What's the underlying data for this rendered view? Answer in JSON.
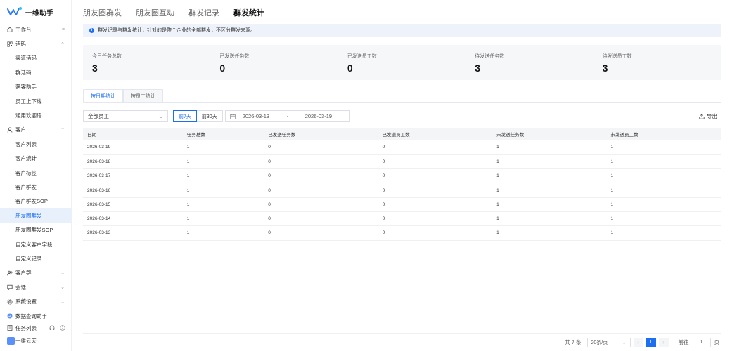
{
  "app": {
    "logo_text": "一维助手"
  },
  "sidebar": {
    "items": [
      {
        "label": "工作台",
        "icon": "home-icon",
        "right": "≡",
        "indent": false
      },
      {
        "label": "活码",
        "icon": "qrcode-icon",
        "right": "⌃",
        "indent": false
      },
      {
        "label": "渠道活码",
        "icon": "",
        "right": "",
        "indent": true
      },
      {
        "label": "群活码",
        "icon": "",
        "right": "",
        "indent": true
      },
      {
        "label": "获客助手",
        "icon": "",
        "right": "",
        "indent": true
      },
      {
        "label": "员工上下线",
        "icon": "",
        "right": "",
        "indent": true
      },
      {
        "label": "通用欢迎语",
        "icon": "",
        "right": "",
        "indent": true
      },
      {
        "label": "客户",
        "icon": "user-icon",
        "right": "⌃",
        "indent": false
      },
      {
        "label": "客户列表",
        "icon": "",
        "right": "",
        "indent": true
      },
      {
        "label": "客户统计",
        "icon": "",
        "right": "",
        "indent": true
      },
      {
        "label": "客户标签",
        "icon": "",
        "right": "",
        "indent": true
      },
      {
        "label": "客户群发",
        "icon": "",
        "right": "",
        "indent": true
      },
      {
        "label": "客户群发SOP",
        "icon": "",
        "right": "",
        "indent": true
      },
      {
        "label": "朋友圈群发",
        "icon": "",
        "right": "",
        "indent": true,
        "active": true
      },
      {
        "label": "朋友圈群发SOP",
        "icon": "",
        "right": "",
        "indent": true
      },
      {
        "label": "自定义客户字段",
        "icon": "",
        "right": "",
        "indent": true
      },
      {
        "label": "自定义记录",
        "icon": "",
        "right": "",
        "indent": true
      },
      {
        "label": "客户群",
        "icon": "group-icon",
        "right": "⌄",
        "indent": false
      },
      {
        "label": "会话",
        "icon": "chat-icon",
        "right": "⌄",
        "indent": false
      },
      {
        "label": "系统设置",
        "icon": "gear-icon",
        "right": "⌄",
        "indent": false
      },
      {
        "label": "数据查询助手",
        "icon": "data-icon",
        "right": "",
        "indent": false
      }
    ],
    "task_list": "任务列表",
    "user_name": "一维云天"
  },
  "top_tabs": [
    "朋友圈群发",
    "朋友圈互动",
    "群发记录",
    "群发统计"
  ],
  "top_tab_active": "群发统计",
  "notice": "群发记录与群发统计，针对的是整个企业的全部群发，不区分群发来源。",
  "stats": [
    {
      "label": "今日任务总数",
      "value": "3"
    },
    {
      "label": "已发送任务数",
      "value": "0"
    },
    {
      "label": "已发送员工数",
      "value": "0"
    },
    {
      "label": "待发送任务数",
      "value": "3"
    },
    {
      "label": "待发送员工数",
      "value": "3"
    }
  ],
  "sub_tabs": [
    "按日期统计",
    "按员工统计"
  ],
  "filter": {
    "employee": "全部员工",
    "ranges": [
      "前7天",
      "前30天"
    ],
    "date_start": "2026-03-13",
    "date_sep": "-",
    "date_end": "2026-03-19",
    "export": "导出"
  },
  "table": {
    "headers": [
      "日期",
      "任务总数",
      "已发送任务数",
      "已发送员工数",
      "未发送任务数",
      "未发送员工数"
    ],
    "rows": [
      [
        "2026-03-19",
        "1",
        "0",
        "0",
        "1",
        "1"
      ],
      [
        "2026-03-18",
        "1",
        "0",
        "0",
        "1",
        "1"
      ],
      [
        "2026-03-17",
        "1",
        "0",
        "0",
        "1",
        "1"
      ],
      [
        "2026-03-16",
        "1",
        "0",
        "0",
        "1",
        "1"
      ],
      [
        "2026-03-15",
        "1",
        "0",
        "0",
        "1",
        "1"
      ],
      [
        "2026-03-14",
        "1",
        "0",
        "0",
        "1",
        "1"
      ],
      [
        "2026-03-13",
        "1",
        "0",
        "0",
        "1",
        "1"
      ]
    ]
  },
  "pagination": {
    "total": "共 7 条",
    "page_size": "20条/页",
    "current": "1",
    "goto": "前往",
    "goto_value": "1",
    "page_unit": "页"
  },
  "colors": {
    "accent": "#1d6ff2"
  }
}
